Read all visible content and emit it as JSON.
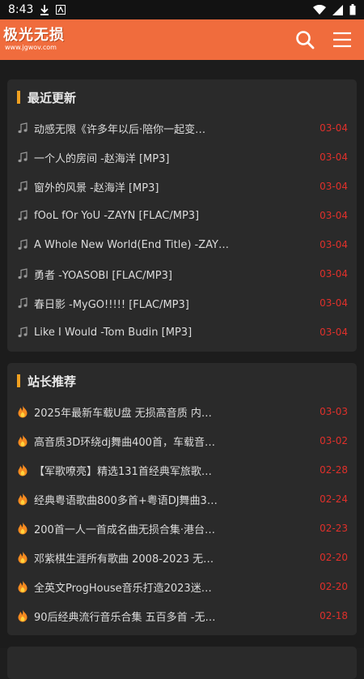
{
  "status_bar": {
    "time": "8:43"
  },
  "header": {
    "logo_text": "极光无损",
    "logo_domain": "www.jgwov.com",
    "accent_color": "#f06c3d"
  },
  "sections": [
    {
      "title": "最近更新",
      "icon": "music-note-icon",
      "items": [
        {
          "title": "动感无限《许多年以后·陪你一起变…",
          "date": "03-04"
        },
        {
          "title": "一个人的房间 -赵海洋 [MP3]",
          "date": "03-04"
        },
        {
          "title": "窗外的风景 -赵海洋 [MP3]",
          "date": "03-04"
        },
        {
          "title": "fOoL fOr YoU -ZAYN [FLAC/MP3]",
          "date": "03-04"
        },
        {
          "title": "A Whole New World(End Title) -ZAY…",
          "date": "03-04"
        },
        {
          "title": "勇者 -YOASOBI [FLAC/MP3]",
          "date": "03-04"
        },
        {
          "title": "春日影 -MyGO!!!!! [FLAC/MP3]",
          "date": "03-04"
        },
        {
          "title": "Like I Would -Tom Budin [MP3]",
          "date": "03-04"
        }
      ]
    },
    {
      "title": "站长推荐",
      "icon": "fire-icon",
      "items": [
        {
          "title": "2025年最新车载U盘 无损高音质 内…",
          "date": "03-03"
        },
        {
          "title": "高音质3D环绕dj舞曲400首，车载音…",
          "date": "03-02"
        },
        {
          "title": "【军歌嘹亮】精选131首经典军旅歌…",
          "date": "02-28"
        },
        {
          "title": "经典粤语歌曲800多首+粤语DJ舞曲3…",
          "date": "02-24"
        },
        {
          "title": "200首一人一首成名曲无损合集·港台…",
          "date": "02-23"
        },
        {
          "title": "邓紫棋生涯所有歌曲 2008-2023 无…",
          "date": "02-20"
        },
        {
          "title": "全英文ProgHouse音乐打造2023迷…",
          "date": "02-20"
        },
        {
          "title": "90后经典流行音乐合集 五百多首 -无…",
          "date": "02-18"
        }
      ]
    }
  ]
}
